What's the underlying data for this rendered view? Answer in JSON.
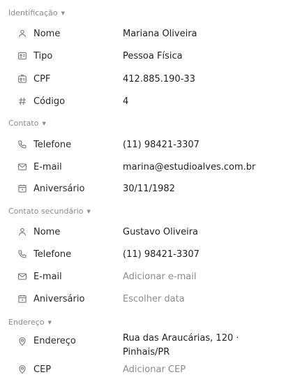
{
  "sections": {
    "identificacao": {
      "title": "Identificação",
      "nome": {
        "label": "Nome",
        "value": "Mariana Oliveira"
      },
      "tipo": {
        "label": "Tipo",
        "value": "Pessoa Física"
      },
      "cpf": {
        "label": "CPF",
        "value": "412.885.190-33"
      },
      "codigo": {
        "label": "Código",
        "value": "4"
      }
    },
    "contato": {
      "title": "Contato",
      "telefone": {
        "label": "Telefone",
        "value": "(11) 98421-3307"
      },
      "email": {
        "label": "E-mail",
        "value": "marina@estudioalves.com.br"
      },
      "aniversario": {
        "label": "Aniversário",
        "value": "30/11/1982"
      }
    },
    "contato_secundario": {
      "title": "Contato secundário",
      "nome": {
        "label": "Nome",
        "value": "Gustavo Oliveira"
      },
      "telefone": {
        "label": "Telefone",
        "value": "(11) 98421-3307"
      },
      "email": {
        "label": "E-mail",
        "placeholder": "Adicionar e-mail"
      },
      "aniversario": {
        "label": "Aniversário",
        "placeholder": "Escolher data"
      }
    },
    "endereco": {
      "title": "Endereço",
      "endereco": {
        "label": "Endereço",
        "value": "Rua das Araucárias, 120 · Pinhais/PR"
      },
      "cep": {
        "label": "CEP",
        "placeholder": "Adicionar CEP"
      }
    }
  },
  "icons": {
    "person": "person-icon",
    "id_card": "id-card-icon",
    "badge": "badge-icon",
    "hash": "hash-icon",
    "phone": "phone-icon",
    "mail": "mail-icon",
    "calendar": "calendar-icon",
    "location": "location-pin-icon"
  },
  "colors": {
    "header_text": "#8a8a8a",
    "icon": "#7b7b7b",
    "placeholder": "#8c8c8c",
    "value_text": "#1f1f1f"
  }
}
